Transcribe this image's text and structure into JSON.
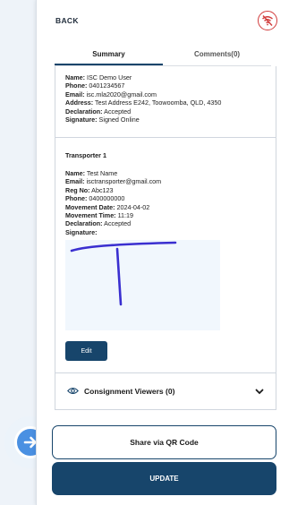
{
  "header": {
    "back_label": "BACK",
    "status_icon": "wifi-off-icon",
    "status_color": "#d13b3b"
  },
  "tabs": [
    {
      "label": "Summary",
      "active": true
    },
    {
      "label": "Comments(0)",
      "active": false
    }
  ],
  "owner": {
    "name_label": "Name:",
    "name": "ISC Demo User",
    "phone_label": "Phone:",
    "phone": "0401234567",
    "email_label": "Email:",
    "email": "isc.mla2020@gmail.com",
    "address_label": "Address:",
    "address": "Test Address E242, Toowoomba, QLD, 4350",
    "declaration_label": "Declaration:",
    "declaration": "Accepted",
    "signature_label": "Signature:",
    "signature": "Signed Online"
  },
  "transporter": {
    "title": "Transporter 1",
    "name_label": "Name:",
    "name": "Test Name",
    "email_label": "Email:",
    "email": "isctransporter@gmail.com",
    "reg_label": "Reg No:",
    "reg": "Abc123",
    "phone_label": "Phone:",
    "phone": "0400000000",
    "movement_date_label": "Movement Date:",
    "movement_date": "2024-04-02",
    "movement_time_label": "Movement Time:",
    "movement_time": "11:19",
    "declaration_label": "Declaration:",
    "declaration": "Accepted",
    "signature_label": "Signature:",
    "edit_label": "Edit"
  },
  "viewers": {
    "label": "Consignment Viewers (0)"
  },
  "actions": {
    "share_label": "Share via QR Code",
    "update_label": "UPDATE"
  },
  "colors": {
    "primary": "#17456b",
    "float_button": "#4a90e2",
    "signature_ink": "#3a2fd0"
  }
}
